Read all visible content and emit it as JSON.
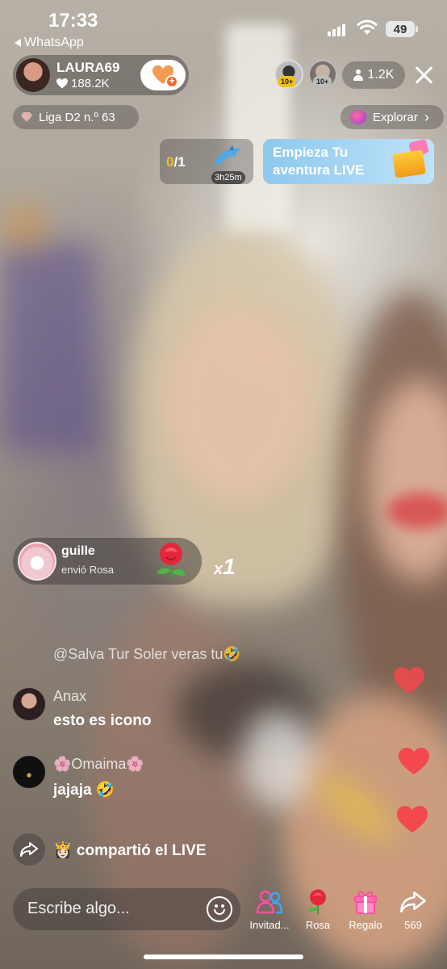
{
  "status_bar": {
    "time": "17:33",
    "back_app": "WhatsApp",
    "battery": "49"
  },
  "host": {
    "name": "LAURA69",
    "likes": "188.2K",
    "follow_icon": "heart-plus-icon"
  },
  "top_viewers": {
    "ranks": [
      "10+",
      "10+"
    ],
    "count": "1.2K"
  },
  "league": {
    "label": "Liga D2 n.º 63"
  },
  "explore": {
    "label": "Explorar",
    "chevron": "›"
  },
  "challenge": {
    "current": "0",
    "total": "/1",
    "timer": "3h25m"
  },
  "promo": {
    "text": "Empieza Tu aventura LIVE"
  },
  "gift": {
    "user": "guille",
    "action": "envió  Rosa",
    "combo_prefix": "x",
    "combo_count": "1"
  },
  "comments": {
    "faded": "@Salva Tur Soler veras tu🤣",
    "items": [
      {
        "user": "Anax",
        "text": "esto es icono"
      },
      {
        "user": "🌸Omaima🌸",
        "text": "jajaja 🤣"
      }
    ],
    "share_event": "👸🏻 compartió el LIVE"
  },
  "bottom_bar": {
    "placeholder": "Escribe algo...",
    "actions": [
      {
        "label": "Invitad...",
        "icon": "invite-guests-icon"
      },
      {
        "label": "Rosa",
        "icon": "rose-icon"
      },
      {
        "label": "Regalo",
        "icon": "gift-icon"
      },
      {
        "label": "569",
        "icon": "share-icon"
      }
    ]
  },
  "colors": {
    "heart": "#f2484e",
    "follow_heart": "#f39b52",
    "promo_bg": "#8ec8ef",
    "challenge_accent": "#f2c01c"
  }
}
